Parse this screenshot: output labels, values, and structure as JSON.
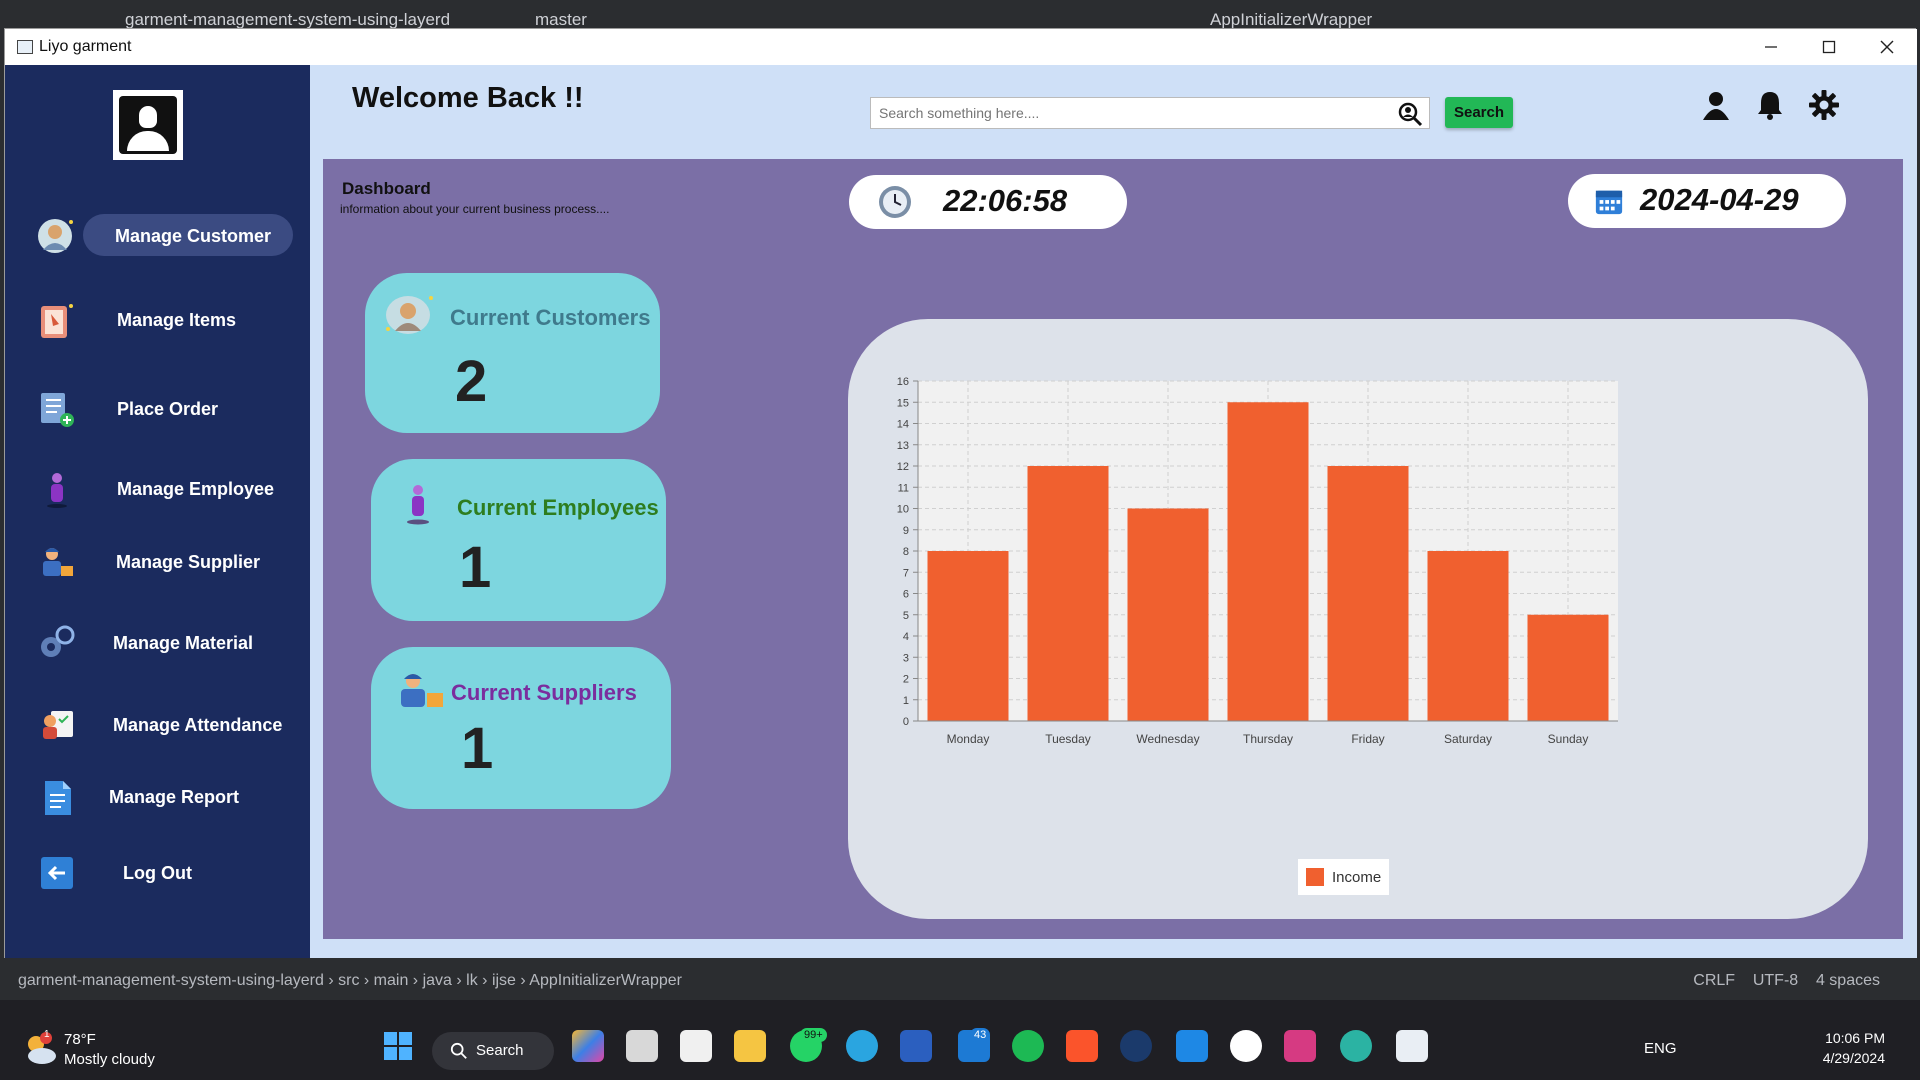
{
  "ide": {
    "project_title": "garment-management-system-using-layerd",
    "branch": "master",
    "run_config": "AppInitializerWrapper"
  },
  "window": {
    "title": "Liyo garment"
  },
  "sidebar": {
    "items": [
      {
        "label": "Manage Customer",
        "active": true
      },
      {
        "label": "Manage Items"
      },
      {
        "label": "Place Order"
      },
      {
        "label": "Manage Employee"
      },
      {
        "label": "Manage Supplier"
      },
      {
        "label": "Manage Material"
      },
      {
        "label": "Manage Attendance"
      },
      {
        "label": "Manage Report"
      },
      {
        "label": "Log Out"
      }
    ]
  },
  "header": {
    "welcome": "Welcome Back !!",
    "search_placeholder": "Search something here....",
    "search_button": "Search"
  },
  "dashboard": {
    "title": "Dashboard",
    "subtitle": "information about your current business process....",
    "time": "22:06:58",
    "date": "2024-04-29",
    "cards": [
      {
        "title": "Current Customers",
        "value": "2",
        "color": "#3f7a8c"
      },
      {
        "title": "Current Employees",
        "value": "1",
        "color": "#2e7d1f"
      },
      {
        "title": "Current Suppliers",
        "value": "1",
        "color": "#7b2d9e"
      }
    ]
  },
  "chart_data": {
    "type": "bar",
    "categories": [
      "Monday",
      "Tuesday",
      "Wednesday",
      "Thursday",
      "Friday",
      "Saturday",
      "Sunday"
    ],
    "series": [
      {
        "name": "Income",
        "values": [
          8,
          12,
          10,
          15,
          12,
          8,
          5
        ]
      }
    ],
    "ylim": [
      0,
      16
    ],
    "yticks": [
      0,
      1,
      2,
      3,
      4,
      5,
      6,
      7,
      8,
      9,
      10,
      11,
      12,
      13,
      14,
      15,
      16
    ],
    "grid": true,
    "legend": "bottom",
    "bar_color": "#f0602f"
  },
  "status": {
    "breadcrumb": [
      "garment-management-system-using-layerd",
      "src",
      "main",
      "java",
      "lk",
      "ijse",
      "AppInitializerWrapper"
    ],
    "line_sep": "CRLF",
    "encoding": "UTF-8",
    "indent": "4 spaces"
  },
  "taskbar": {
    "weather_temp": "78°F",
    "weather_desc": "Mostly cloudy",
    "weather_badge": "1",
    "search_label": "Search",
    "whatsapp_badge": "99+",
    "outlook_badge": "43",
    "language": "ENG",
    "time": "10:06 PM",
    "date": "4/29/2024"
  }
}
